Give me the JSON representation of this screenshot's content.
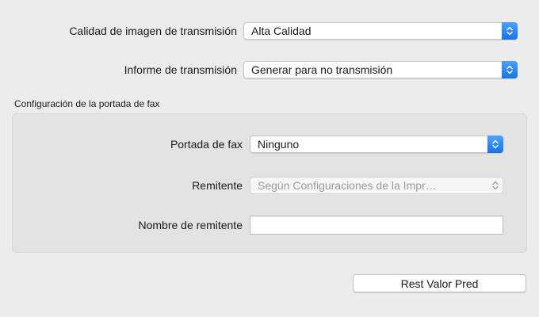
{
  "transmission_quality": {
    "label": "Calidad de imagen de transmisión",
    "value": "Alta Calidad"
  },
  "transmission_report": {
    "label": "Informe de transmisión",
    "value": "Generar para no transmisión"
  },
  "cover_page_section": {
    "title": "Configuración de la portada de fax",
    "cover_page": {
      "label": "Portada de fax",
      "value": "Ninguno"
    },
    "sender": {
      "label": "Remitente",
      "value": "Según Configuraciones de la Impr…",
      "enabled": false
    },
    "sender_name": {
      "label": "Nombre de remitente",
      "value": ""
    }
  },
  "reset_button": {
    "label": "Rest Valor Pred"
  },
  "colors": {
    "accent": "#1473ec",
    "background": "#ececec",
    "group_background": "#e3e3e3"
  }
}
